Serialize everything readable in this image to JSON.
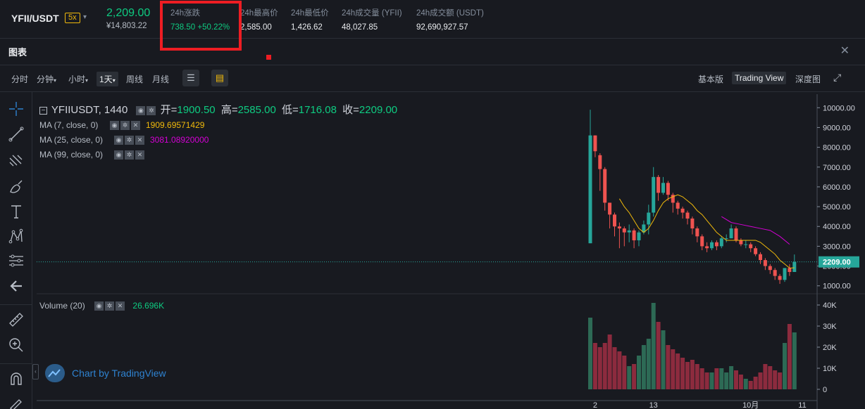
{
  "ticker": {
    "symbol": "YFII/USDT",
    "leverage": "5x",
    "last_price": "2,209.00",
    "fiat_price": "¥14,803.22",
    "stats": [
      {
        "label": "24h涨跌",
        "value": "738.50 +50.22%"
      },
      {
        "label": "24h最高价",
        "value": "2,585.00"
      },
      {
        "label": "24h最低价",
        "value": "1,426.62"
      },
      {
        "label": "24h成交量 (YFII)",
        "value": "48,027.85"
      },
      {
        "label": "24h成交额 (USDT)",
        "value": "92,690,927.57"
      }
    ]
  },
  "panel": {
    "title": "图表"
  },
  "toolbar": {
    "intervals": [
      "分时",
      "分钟",
      "小时",
      "1天",
      "周线",
      "月线"
    ],
    "views": [
      "基本版",
      "Trading View",
      "深度图"
    ]
  },
  "legend": {
    "symbol_interval": "YFIIUSDT, 1440",
    "open_label": "开=",
    "open": "1900.50",
    "high_label": "高=",
    "high": "2585.00",
    "low_label": "低=",
    "low": "1716.08",
    "close_label": "收=",
    "close": "2209.00",
    "ma7_label": "MA (7, close, 0)",
    "ma7_value": "1909.69571429",
    "ma25_label": "MA (25, close, 0)",
    "ma25_value": "3081.08920000",
    "ma99_label": "MA (99, close, 0)",
    "volume_label": "Volume (20)",
    "volume_value": "26.696K"
  },
  "watermark": "Chart by TradingView",
  "colors": {
    "up": "#26a69a",
    "down": "#ef5350",
    "ma7": "#f0b90b",
    "ma25": "#d400d4",
    "bg": "#181a20"
  },
  "chart_data": {
    "type": "candlestick",
    "y_ticks": [
      "10000.00",
      "9000.00",
      "8000.00",
      "7000.00",
      "6000.00",
      "5000.00",
      "4000.00",
      "3000.00",
      "2000.00",
      "1000.00"
    ],
    "ylim": [
      600,
      10400
    ],
    "vol_ticks": [
      "40K",
      "30K",
      "20K",
      "10K",
      "0"
    ],
    "vol_lim": [
      0,
      42000
    ],
    "x_ticks": [
      "2",
      "13",
      "10月",
      "11"
    ],
    "current_price": "2209.00",
    "candles": [
      [
        3150,
        8600,
        9900,
        3150,
        34000
      ],
      [
        8600,
        7800,
        8600,
        7500,
        22000
      ],
      [
        7600,
        6900,
        7700,
        5800,
        20000
      ],
      [
        6900,
        5200,
        7000,
        4800,
        22000
      ],
      [
        5200,
        4600,
        5200,
        3900,
        26000
      ],
      [
        4600,
        4000,
        4700,
        3500,
        20000
      ],
      [
        4000,
        3900,
        4200,
        2900,
        18000
      ],
      [
        3900,
        3700,
        4000,
        3000,
        16000
      ],
      [
        3700,
        3800,
        4100,
        3200,
        11000
      ],
      [
        3800,
        3300,
        3900,
        2900,
        12000
      ],
      [
        3300,
        3700,
        3800,
        3000,
        16000
      ],
      [
        3700,
        4100,
        4300,
        3600,
        21000
      ],
      [
        4100,
        4700,
        5100,
        3600,
        24000
      ],
      [
        4700,
        6500,
        7000,
        4500,
        41000
      ],
      [
        6500,
        5700,
        6600,
        5300,
        32000
      ],
      [
        5700,
        6200,
        6500,
        5600,
        28000
      ],
      [
        6200,
        5600,
        6300,
        5300,
        21000
      ],
      [
        5600,
        5200,
        5700,
        4700,
        19000
      ],
      [
        5200,
        4900,
        5300,
        4600,
        17000
      ],
      [
        4900,
        4700,
        5000,
        4400,
        15000
      ],
      [
        4700,
        4400,
        4800,
        4100,
        13000
      ],
      [
        4400,
        3900,
        4500,
        3600,
        14000
      ],
      [
        3900,
        3500,
        4000,
        3200,
        12000
      ],
      [
        3500,
        3000,
        3600,
        2800,
        10000
      ],
      [
        3000,
        2900,
        3200,
        2700,
        8000
      ],
      [
        2900,
        3200,
        3300,
        2800,
        8000
      ],
      [
        3200,
        3000,
        3300,
        2800,
        10000
      ],
      [
        3000,
        3400,
        3500,
        2900,
        10000
      ],
      [
        3400,
        3400,
        3600,
        3200,
        8000
      ],
      [
        3400,
        3900,
        4100,
        3400,
        11000
      ],
      [
        3900,
        3300,
        4000,
        3200,
        9000
      ],
      [
        3300,
        3100,
        3400,
        3000,
        7000
      ],
      [
        3100,
        3100,
        3300,
        2900,
        5000
      ],
      [
        3100,
        2900,
        3200,
        2700,
        4000
      ],
      [
        2900,
        2600,
        3000,
        2500,
        6000
      ],
      [
        2600,
        2300,
        2700,
        2100,
        8000
      ],
      [
        2300,
        2000,
        2400,
        1800,
        12000
      ],
      [
        2000,
        1800,
        2100,
        1600,
        11000
      ],
      [
        1800,
        1500,
        1900,
        1300,
        9000
      ],
      [
        1500,
        1300,
        1600,
        1100,
        8000
      ],
      [
        1300,
        1900,
        1900,
        1200,
        22000
      ],
      [
        1900,
        1700,
        2100,
        1500,
        31000
      ],
      [
        1700,
        2209,
        2585,
        1700,
        27000
      ]
    ],
    "ma7": [
      null,
      null,
      null,
      null,
      null,
      null,
      5400,
      5000,
      4700,
      4300,
      3900,
      3700,
      3900,
      4300,
      4800,
      5200,
      5400,
      5500,
      5600,
      5500,
      5300,
      5100,
      4800,
      4600,
      4300,
      4000,
      3700,
      3500,
      3300,
      3300,
      3300,
      3300,
      3300,
      3300,
      3300,
      3200,
      3000,
      2800,
      2600,
      2300,
      2100,
      1900,
      1909
    ]
  }
}
